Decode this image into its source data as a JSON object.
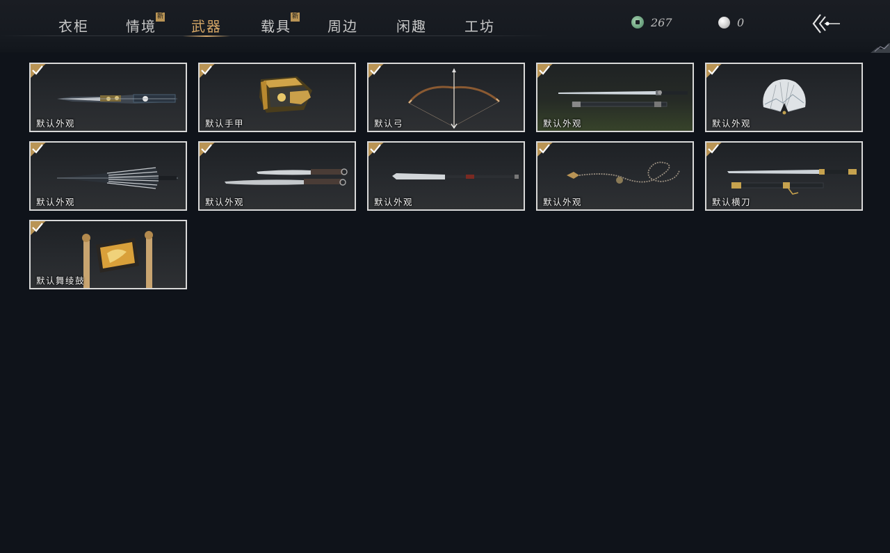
{
  "nav": {
    "tabs": [
      {
        "label": "衣柜",
        "active": false,
        "new": false
      },
      {
        "label": "情境",
        "active": false,
        "new": true
      },
      {
        "label": "武器",
        "active": true,
        "new": false
      },
      {
        "label": "载具",
        "active": false,
        "new": true
      },
      {
        "label": "周边",
        "active": false,
        "new": false
      },
      {
        "label": "闲趣",
        "active": false,
        "new": false
      },
      {
        "label": "工坊",
        "active": false,
        "new": false
      }
    ],
    "new_badge": "新"
  },
  "currency": {
    "jade": {
      "icon": "jade-coin-icon",
      "value": "267"
    },
    "pearl": {
      "icon": "pearl-icon",
      "value": "0"
    }
  },
  "back_button": {
    "icon": "back-arrow-icon"
  },
  "items": [
    {
      "label": "默认外观",
      "icon": "umbrella-weapon-icon",
      "owned": true
    },
    {
      "label": "默认手甲",
      "icon": "gauntlet-icon",
      "owned": true
    },
    {
      "label": "默认弓",
      "icon": "bow-icon",
      "owned": true
    },
    {
      "label": "默认外观",
      "icon": "twin-swords-icon",
      "owned": true
    },
    {
      "label": "默认外观",
      "icon": "fan-icon",
      "owned": true
    },
    {
      "label": "默认外观",
      "icon": "closed-umbrella-icon",
      "owned": true
    },
    {
      "label": "默认外观",
      "icon": "twin-dao-icon",
      "owned": true
    },
    {
      "label": "默认外观",
      "icon": "glaive-icon",
      "owned": true
    },
    {
      "label": "默认外观",
      "icon": "rope-dart-icon",
      "owned": true
    },
    {
      "label": "默认横刀",
      "icon": "hengdao-icon",
      "owned": true
    },
    {
      "label": "默认舞绫鼓",
      "icon": "drum-icon",
      "owned": true
    }
  ],
  "colors": {
    "background": "#0f131a",
    "accent": "#d6a766",
    "card_border": "#d9d9d9",
    "check_badge": "#b99455"
  }
}
